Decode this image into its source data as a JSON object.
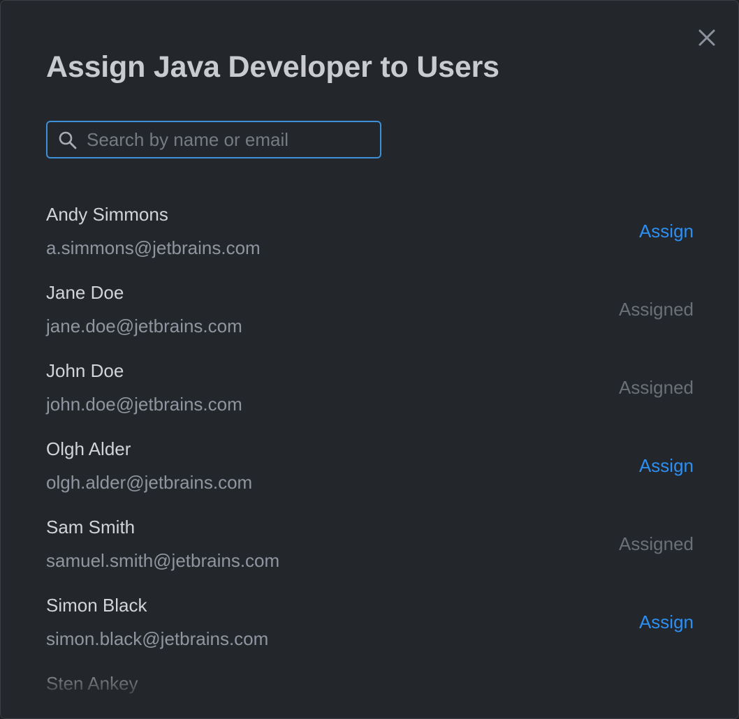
{
  "dialog": {
    "title": "Assign Java Developer to Users",
    "close_icon": "close-icon"
  },
  "search": {
    "placeholder": "Search by name or email",
    "value": "",
    "icon": "search-icon",
    "border_color": "#3d8fd9"
  },
  "colors": {
    "background": "#23262b",
    "accent": "#2d8ff0",
    "muted": "#6b7078"
  },
  "users": [
    {
      "name": "Andy Simmons",
      "email": "a.simmons@jetbrains.com",
      "action": "Assign",
      "assigned": false
    },
    {
      "name": "Jane Doe",
      "email": "jane.doe@jetbrains.com",
      "action": "Assigned",
      "assigned": true
    },
    {
      "name": "John Doe",
      "email": "john.doe@jetbrains.com",
      "action": "Assigned",
      "assigned": true
    },
    {
      "name": "Olgh Alder",
      "email": "olgh.alder@jetbrains.com",
      "action": "Assign",
      "assigned": false
    },
    {
      "name": "Sam Smith",
      "email": "samuel.smith@jetbrains.com",
      "action": "Assigned",
      "assigned": true
    },
    {
      "name": "Simon Black",
      "email": "simon.black@jetbrains.com",
      "action": "Assign",
      "assigned": false
    },
    {
      "name": "Sten Ankey",
      "email": "",
      "action": "",
      "assigned": false
    }
  ]
}
